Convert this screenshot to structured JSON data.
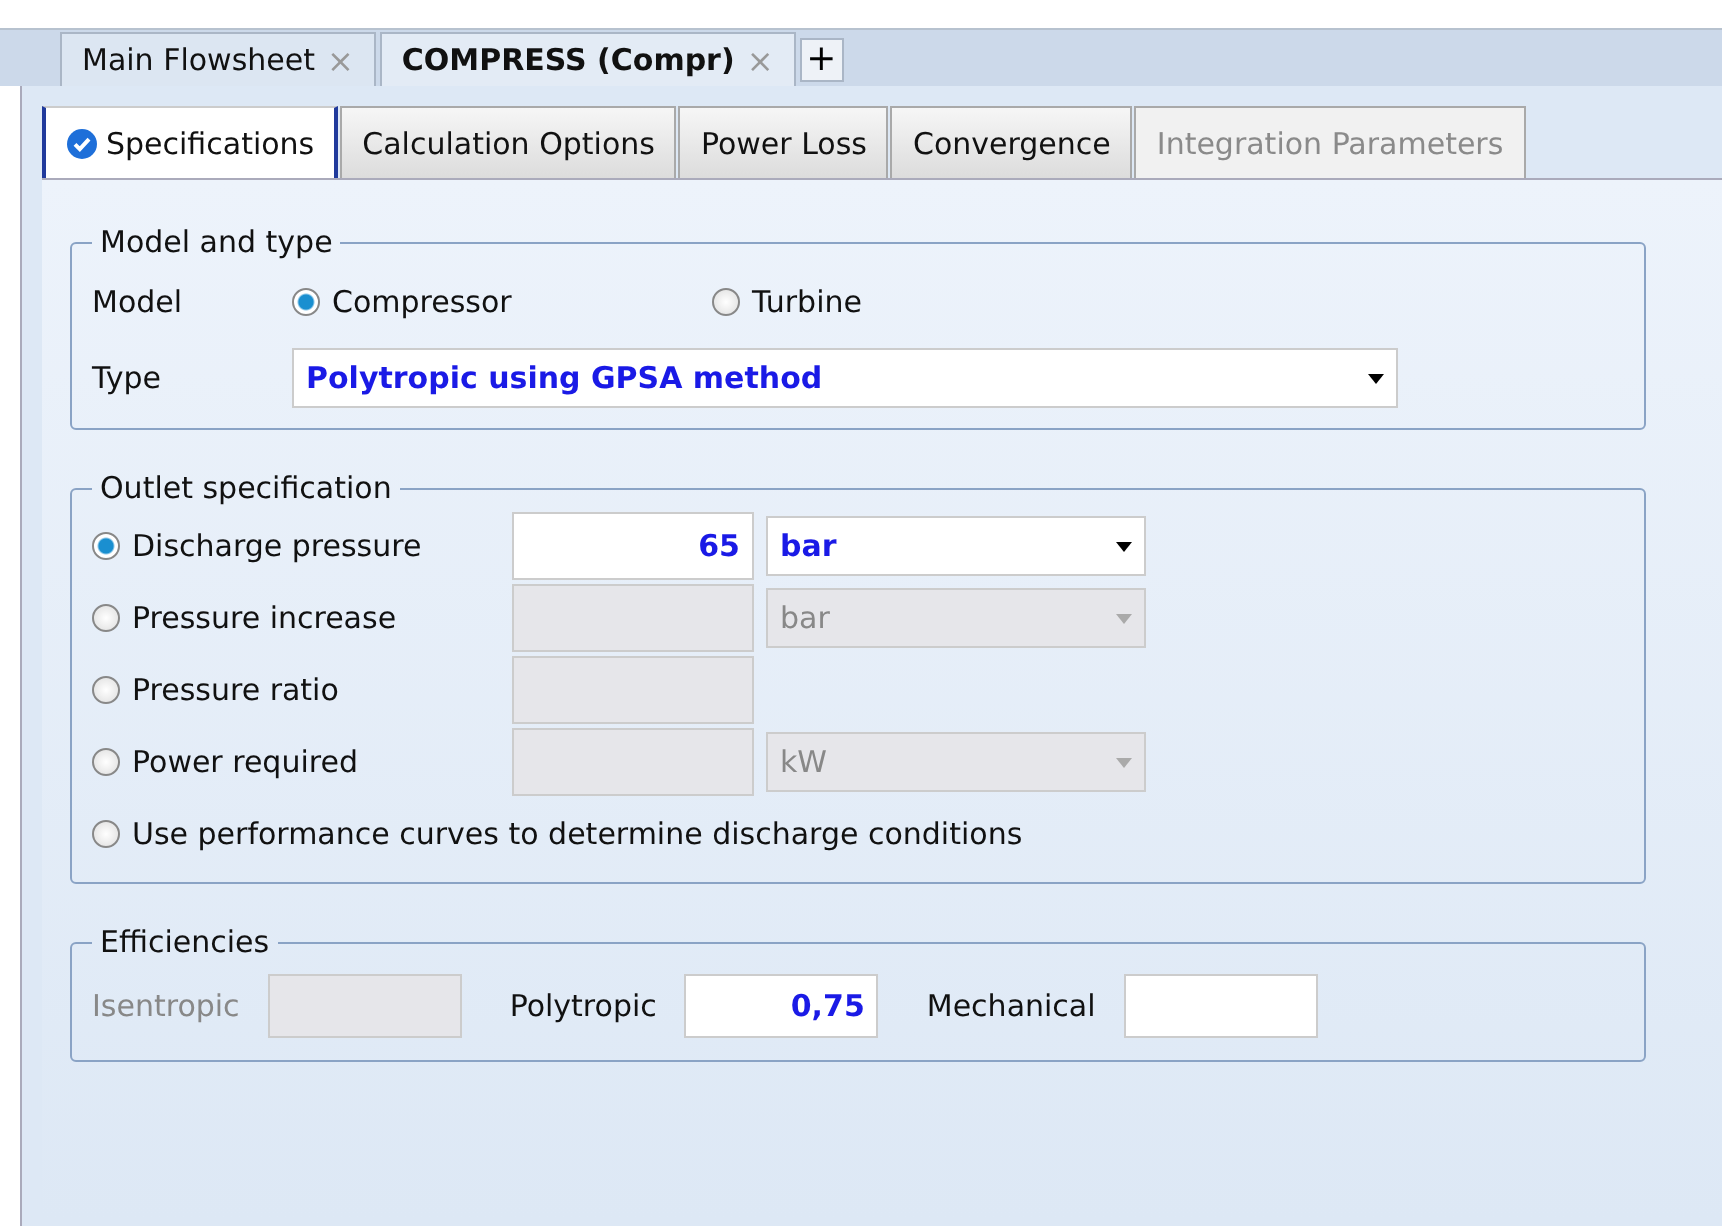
{
  "doc_tabs": [
    {
      "label": "Main Flowsheet",
      "selected": false,
      "close": "×"
    },
    {
      "label": "COMPRESS (Compr)",
      "selected": true,
      "close": "×"
    }
  ],
  "add_tab": "+",
  "tabs": [
    {
      "label": "Specifications",
      "selected": true,
      "disabled": false,
      "complete": true
    },
    {
      "label": "Calculation Options",
      "selected": false,
      "disabled": false,
      "complete": false
    },
    {
      "label": "Power Loss",
      "selected": false,
      "disabled": false,
      "complete": false
    },
    {
      "label": "Convergence",
      "selected": false,
      "disabled": false,
      "complete": false
    },
    {
      "label": "Integration Parameters",
      "selected": false,
      "disabled": true,
      "complete": false
    }
  ],
  "model_and_type": {
    "title": "Model and type",
    "model_label": "Model",
    "models": [
      {
        "label": "Compressor",
        "selected": true
      },
      {
        "label": "Turbine",
        "selected": false
      }
    ],
    "type_label": "Type",
    "type_value": "Polytropic using GPSA method"
  },
  "outlet_specification": {
    "title": "Outlet specification",
    "options": [
      {
        "kind": "value_unit",
        "label": "Discharge pressure",
        "selected": true,
        "value": "65",
        "unit": "bar",
        "disabled": false
      },
      {
        "kind": "value_unit",
        "label": "Pressure increase",
        "selected": false,
        "unit": "bar",
        "disabled": true
      },
      {
        "kind": "value",
        "label": "Pressure ratio",
        "selected": false,
        "disabled": true
      },
      {
        "kind": "value_unit",
        "label": "Power required",
        "selected": false,
        "unit": "kW",
        "disabled": true
      },
      {
        "kind": "none",
        "label": "Use performance curves to determine discharge conditions",
        "selected": false
      }
    ]
  },
  "efficiencies": {
    "title": "Efficiencies",
    "fields": [
      {
        "label": "Isentropic",
        "disabled": true
      },
      {
        "label": "Polytropic",
        "value": "0,75",
        "disabled": false
      },
      {
        "label": "Mechanical",
        "disabled": false
      }
    ]
  }
}
